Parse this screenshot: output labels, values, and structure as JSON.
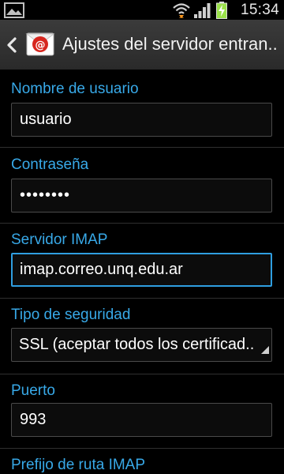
{
  "status_bar": {
    "time": "15:34",
    "left_icons": [
      "image-notification-icon"
    ],
    "right_icons": [
      "wifi-icon",
      "signal-icon",
      "battery-charging-icon"
    ]
  },
  "action_bar": {
    "back_icon": "chevron-left-icon",
    "app_icon": "email-app-icon",
    "title": "Ajustes del servidor entran.."
  },
  "form": {
    "username": {
      "label": "Nombre de usuario",
      "value": "usuario"
    },
    "password": {
      "label": "Contraseña",
      "value": "••••••••"
    },
    "imap_server": {
      "label": "Servidor IMAP",
      "value": "imap.correo.unq.edu.ar"
    },
    "security_type": {
      "label": "Tipo de seguridad",
      "value": "SSL (aceptar todos los certificad.."
    },
    "port": {
      "label": "Puerto",
      "value": "993"
    },
    "imap_path_prefix": {
      "label": "Prefijo de ruta IMAP"
    }
  },
  "colors": {
    "accent_label": "#38a9e8",
    "focus_border": "#2f9ee0",
    "action_bar": "#333333",
    "background": "#000000"
  }
}
